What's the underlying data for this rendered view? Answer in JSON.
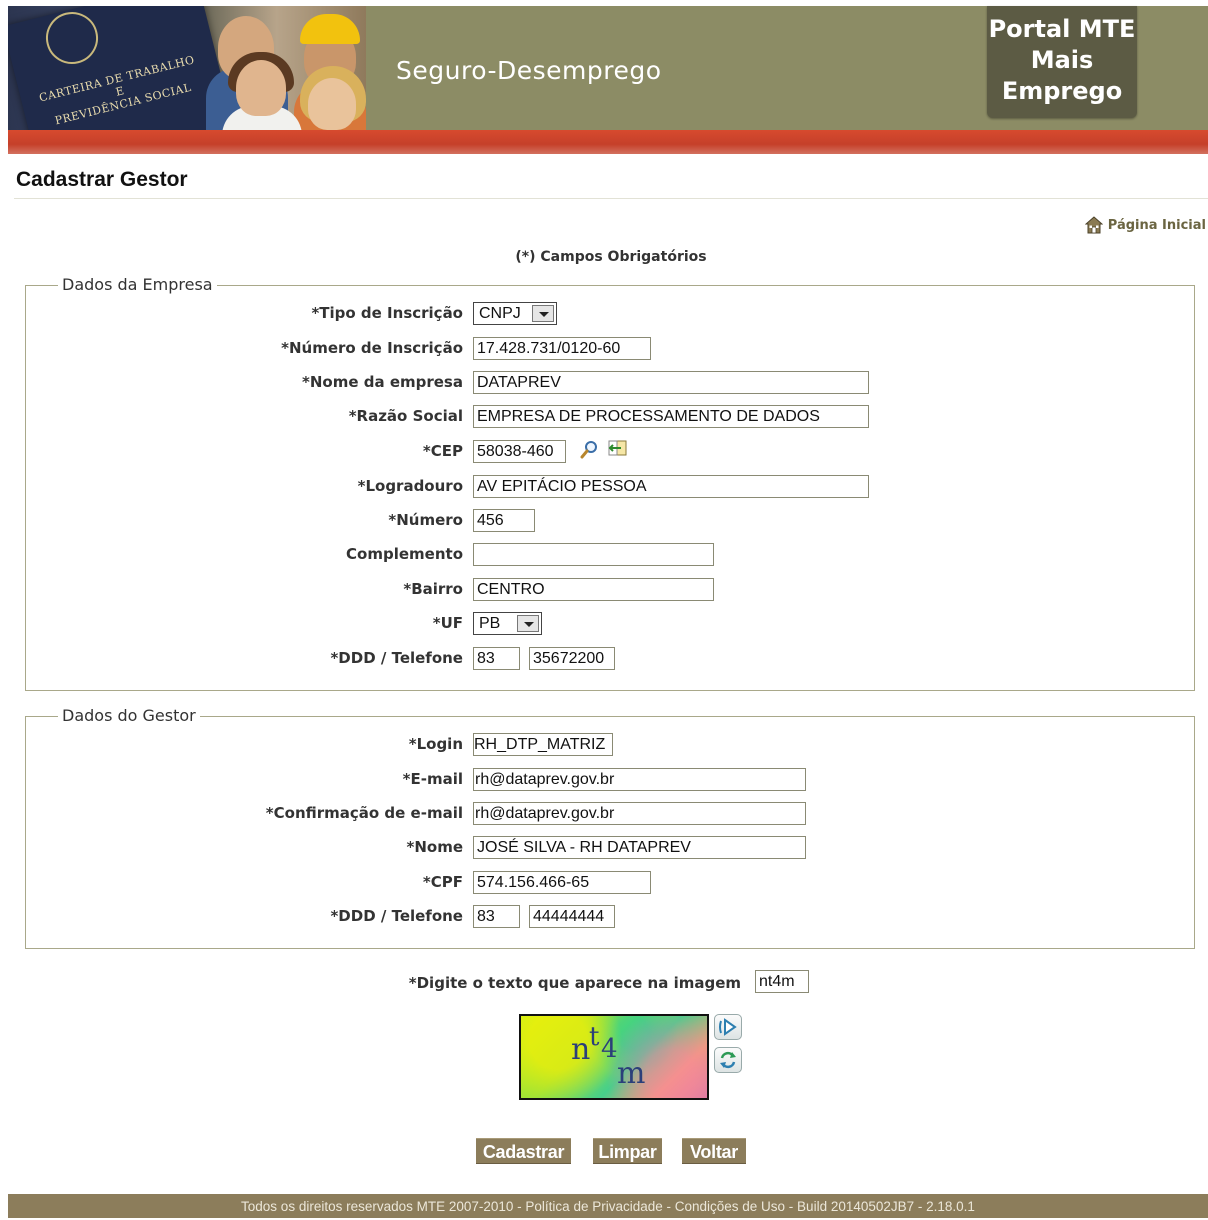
{
  "header": {
    "card_text": [
      "CARTEIRA DE TRABALHO",
      "E",
      "PREVIDÊNCIA SOCIAL"
    ],
    "title": "Seguro-Desemprego",
    "portal": [
      "Portal MTE",
      "Mais",
      "Emprego"
    ]
  },
  "page": {
    "title": "Cadastrar Gestor",
    "home_link": "Página Inicial",
    "required_note": "(*) Campos Obrigatórios"
  },
  "empresa": {
    "legend": "Dados da Empresa",
    "tipo_label": "*Tipo de Inscrição",
    "tipo_value": "CNPJ",
    "numero_inscricao_label": "*Número de Inscrição",
    "numero_inscricao_value": "17.428.731/0120-60",
    "nome_label": "*Nome da empresa",
    "nome_value": "DATAPREV",
    "razao_label": "*Razão Social",
    "razao_value": "EMPRESA DE PROCESSAMENTO DE DADOS",
    "cep_label": "*CEP",
    "cep_value": "58038-460",
    "logradouro_label": "*Logradouro",
    "logradouro_value": "AV EPITÁCIO PESSOA",
    "numero_label": "*Número",
    "numero_value": "456",
    "complemento_label": "Complemento",
    "complemento_value": "",
    "bairro_label": "*Bairro",
    "bairro_value": "CENTRO",
    "uf_label": "*UF",
    "uf_value": "PB",
    "telefone_label": "*DDD / Telefone",
    "ddd_value": "83",
    "telefone_value": "35672200"
  },
  "gestor": {
    "legend": "Dados do Gestor",
    "login_label": "*Login",
    "login_value": "RH_DTP_MATRIZ",
    "email_label": "*E-mail",
    "email_value": "rh@dataprev.gov.br",
    "email_conf_label": "*Confirmação de e-mail",
    "email_conf_value": "rh@dataprev.gov.br",
    "nome_label": "*Nome",
    "nome_value": "JOSÉ SILVA - RH DATAPREV",
    "cpf_label": "*CPF",
    "cpf_value": "574.156.466-65",
    "telefone_label": "*DDD / Telefone",
    "ddd_value": "83",
    "telefone_value": "44444444"
  },
  "captcha": {
    "label": "*Digite o texto que aparece na imagem",
    "value": "nt4m",
    "image_text": [
      "n",
      "t",
      "4",
      "m"
    ]
  },
  "buttons": {
    "cadastrar": "Cadastrar",
    "limpar": "Limpar",
    "voltar": "Voltar"
  },
  "footer": {
    "text": "Todos os direitos reservados MTE 2007-2010 - Política de Privacidade - Condições de Uso - Build 20140502JB7 - 2.18.0.1"
  },
  "icons": {
    "home": "home-icon",
    "cep_search": "magnifier-icon",
    "cep_import": "address-import-icon",
    "audio": "speaker-icon",
    "refresh": "refresh-icon"
  },
  "colors": {
    "header_bg": "#8c8c65",
    "portal_bg": "#5c5b44",
    "red_bar": "#c5402a",
    "button_bg": "#8c7d5b",
    "footer_bg": "#8c7d5b"
  }
}
